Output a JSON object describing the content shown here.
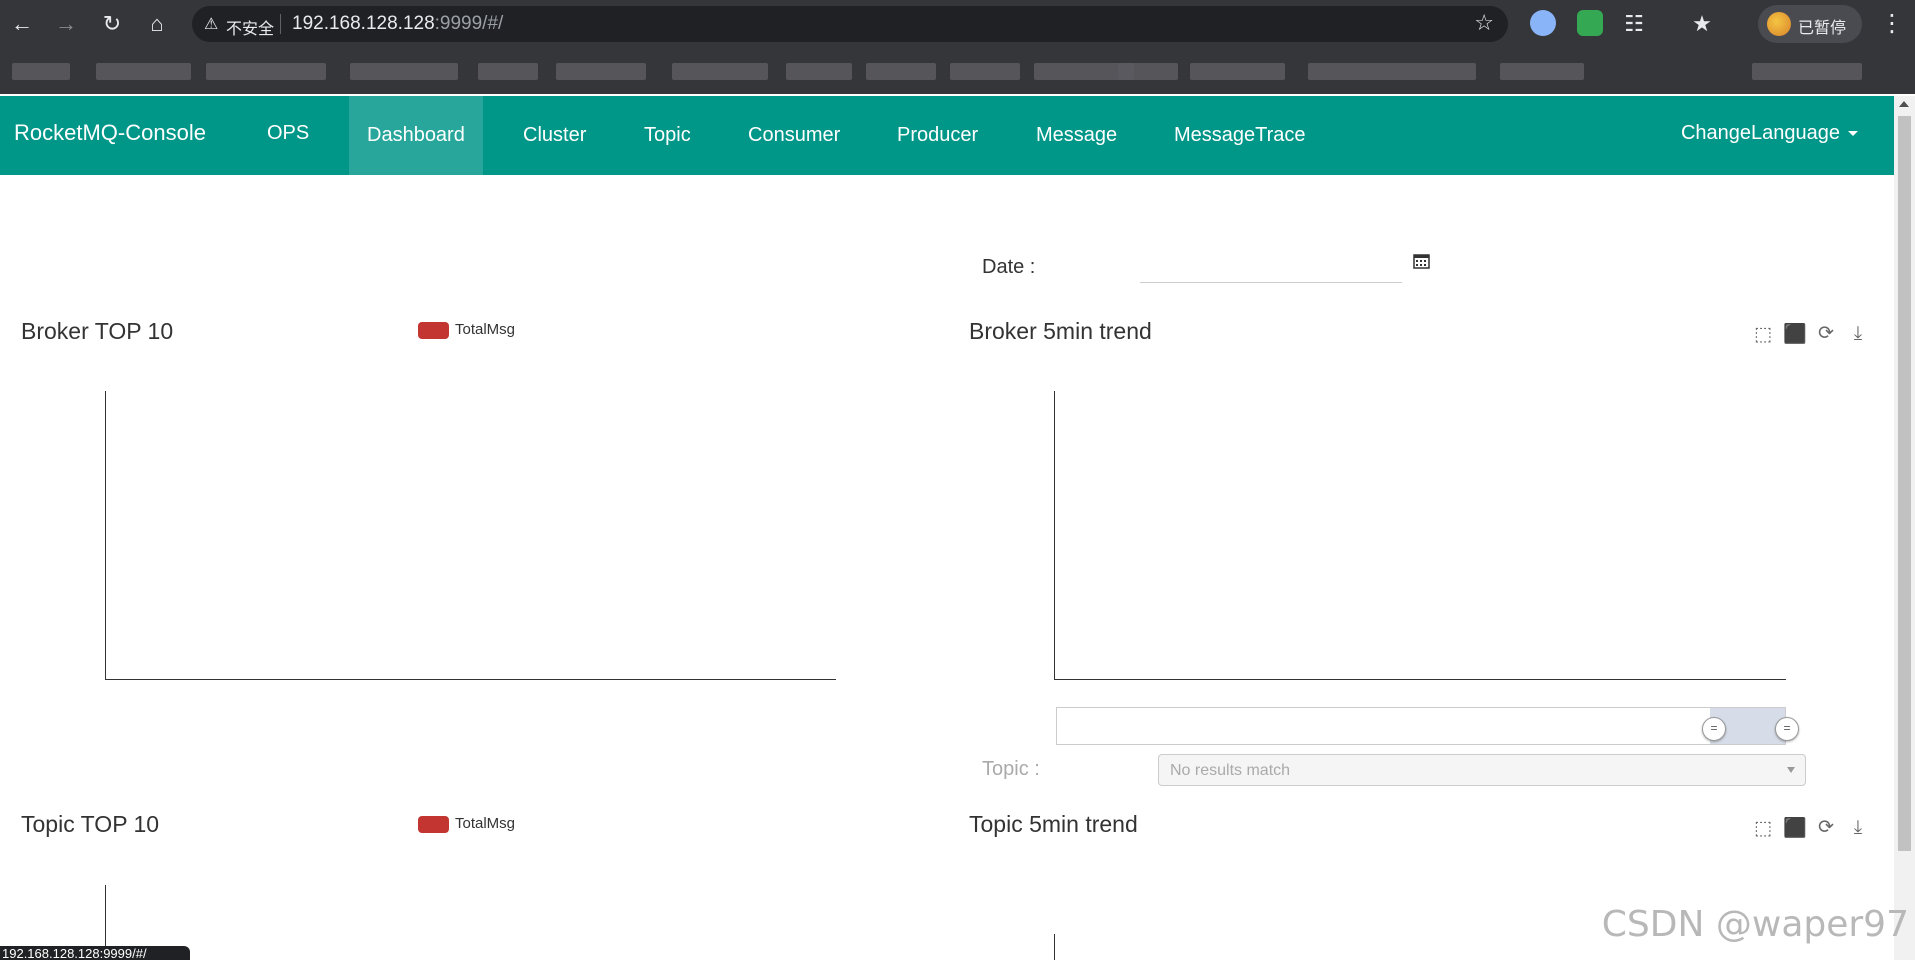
{
  "browser": {
    "security_label": "不安全",
    "url_host": "192.168.128.128",
    "url_rest": ":9999/#/",
    "profile_label": "已暂停",
    "status_url": "192.168.128.128:9999/#/"
  },
  "app": {
    "brand": "RocketMQ-Console",
    "nav": [
      "OPS",
      "Dashboard",
      "Cluster",
      "Topic",
      "Consumer",
      "Producer",
      "Message",
      "MessageTrace"
    ],
    "active_nav": "Dashboard",
    "change_language": "ChangeLanguage",
    "accent_color": "#009688"
  },
  "filters": {
    "date_label": "Date :",
    "date_value": "",
    "topic_label": "Topic :",
    "topic_placeholder": "No results match"
  },
  "panels": {
    "broker_top10": {
      "title": "Broker TOP 10",
      "legend": "TotalMsg",
      "series_color": "#c23531"
    },
    "broker_trend": {
      "title": "Broker 5min trend"
    },
    "topic_top10": {
      "title": "Topic TOP 10",
      "legend": "TotalMsg",
      "series_color": "#c23531"
    },
    "topic_trend": {
      "title": "Topic 5min trend"
    }
  },
  "watermark": "CSDN @waper97"
}
